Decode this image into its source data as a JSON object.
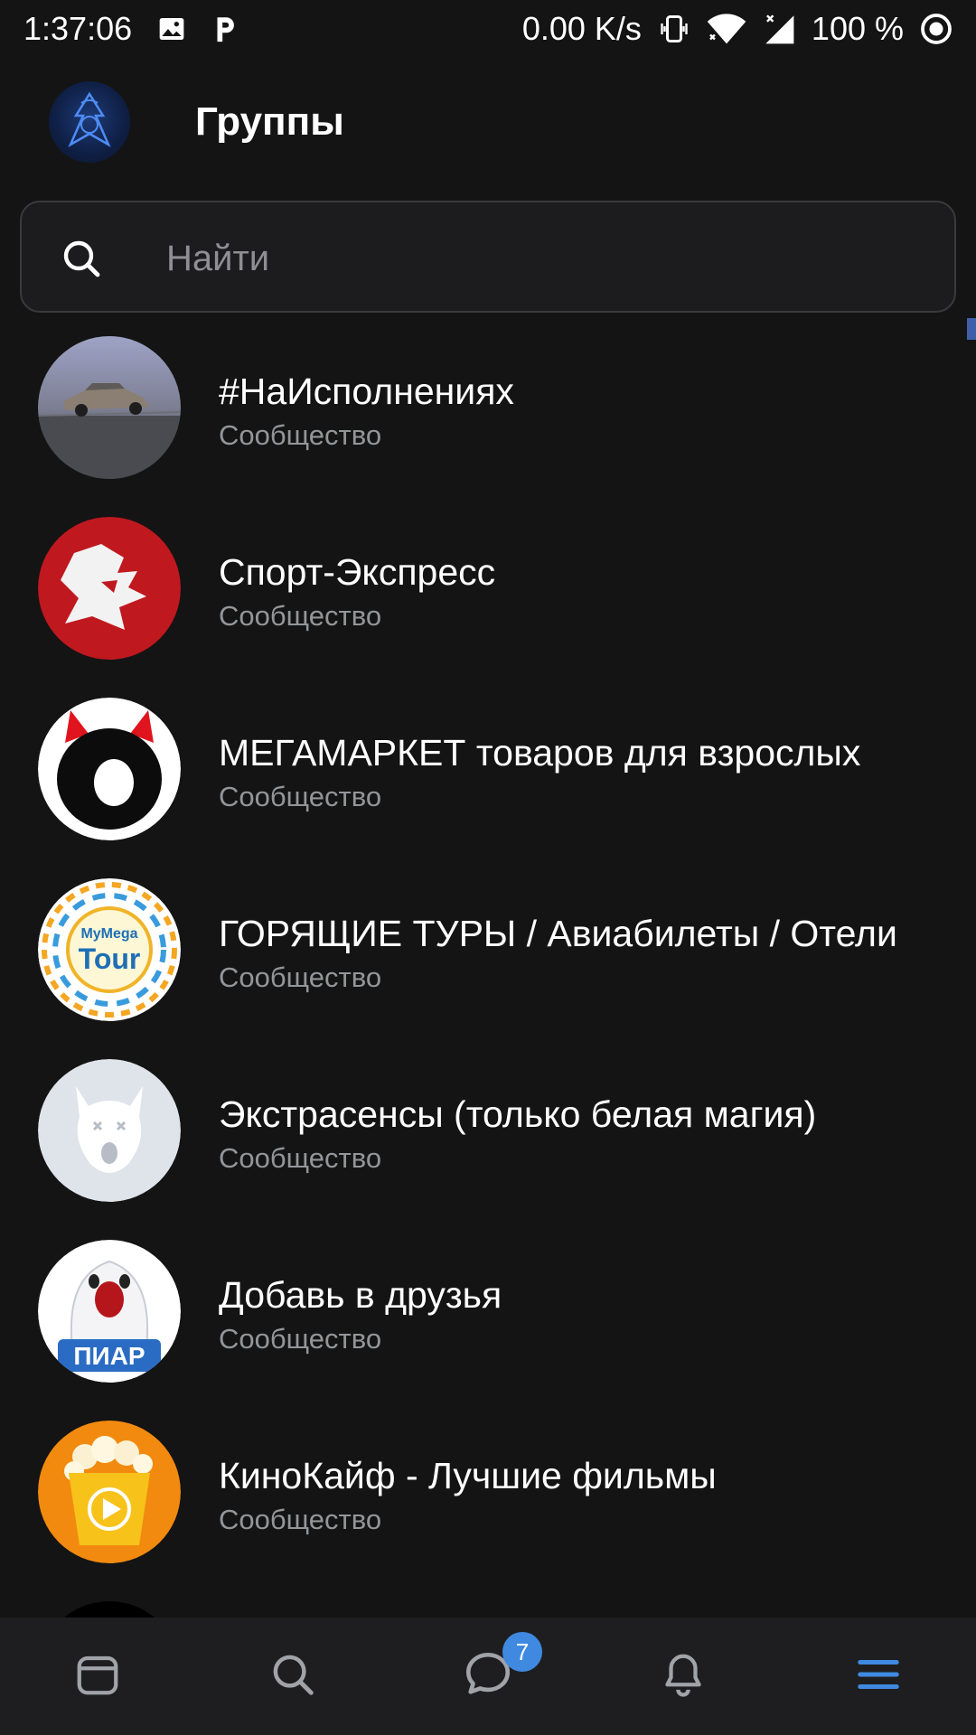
{
  "status_bar": {
    "time": "1:37:06",
    "net_speed": "0.00 K/s",
    "battery": "100 %"
  },
  "header": {
    "title": "Группы"
  },
  "search": {
    "placeholder": "Найти"
  },
  "groups": [
    {
      "name": "#НаИсполнениях",
      "type": "Сообщество"
    },
    {
      "name": "Спорт-Экспресс",
      "type": "Сообщество"
    },
    {
      "name": "МЕГАМАРКЕТ товаров для взрослых",
      "type": "Сообщество"
    },
    {
      "name": "ГОРЯЩИЕ ТУРЫ / Авиабилеты / Отели",
      "type": "Сообщество"
    },
    {
      "name": "Экстрасенсы (только белая магия)",
      "type": "Сообщество"
    },
    {
      "name": "Добавь в друзья",
      "type": "Сообщество"
    },
    {
      "name": "КиноКайф - Лучшие фильмы",
      "type": "Сообщество"
    }
  ],
  "avatar_texts": {
    "tour_top": "MyMega",
    "tour_bottom": "Tour",
    "piar": "ПИАР"
  },
  "bottom_nav": {
    "items": [
      "feed-icon",
      "search-icon",
      "messages-icon",
      "notifications-icon",
      "menu-icon"
    ],
    "messages_badge": "7",
    "active": "menu",
    "accent_color": "#3f8ae0"
  }
}
